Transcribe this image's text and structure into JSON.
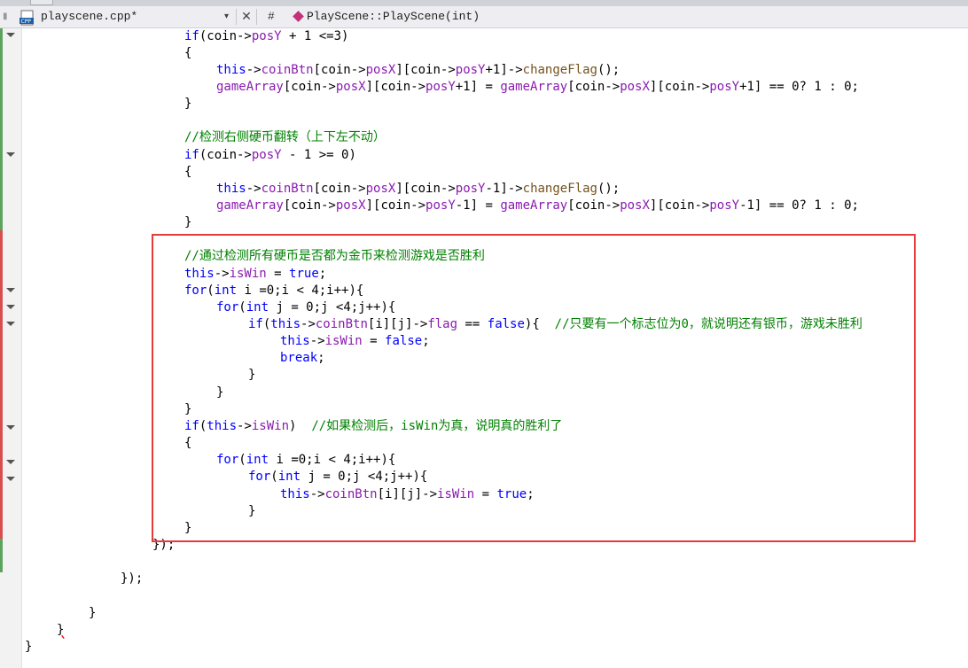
{
  "nav": {
    "file_icon_label": "CPP",
    "file_tab": "playscene.cpp*",
    "dropdown_arrow": "▾",
    "close_glyph": "✕",
    "scope": "#",
    "member": "PlayScene::PlayScene(int)"
  },
  "colors": {
    "keyword": "#0000ff",
    "member": "#8a1bb0",
    "function": "#74531f",
    "comment": "#008000",
    "annotation_box": "#e53b3b"
  },
  "code": {
    "lines": [
      "if(coin->posY + 1 <=3)",
      "{",
      "this->coinBtn[coin->posX][coin->posY+1]->changeFlag();",
      "gameArray[coin->posX][coin->posY+1] = gameArray[coin->posX][coin->posY+1] == 0? 1 : 0;",
      "}",
      "",
      "//检测右侧硬币翻转（上下左不动）",
      "if(coin->posY - 1 >= 0)",
      "{",
      "this->coinBtn[coin->posX][coin->posY-1]->changeFlag();",
      "gameArray[coin->posX][coin->posY-1] = gameArray[coin->posX][coin->posY-1] == 0? 1 : 0;",
      "}",
      "",
      "//通过检测所有硬币是否都为金币来检测游戏是否胜利",
      "this->isWin = true;",
      "for(int i =0;i < 4;i++){",
      "for(int j = 0;j <4;j++){",
      "if(this->coinBtn[i][j]->flag == false){  //只要有一个标志位为0，就说明还有银币，游戏未胜利",
      "this->isWin = false;",
      "break;",
      "}",
      "}",
      "}",
      "if(this->isWin)  //如果检测后，isWin为真，说明真的胜利了",
      "{",
      "for(int i =0;i < 4;i++){",
      "for(int j = 0;j <4;j++){",
      "this->coinBtn[i][j]->isWin = true;",
      "}",
      "}",
      "});",
      "",
      "});",
      "",
      "}",
      "}",
      "}"
    ]
  }
}
